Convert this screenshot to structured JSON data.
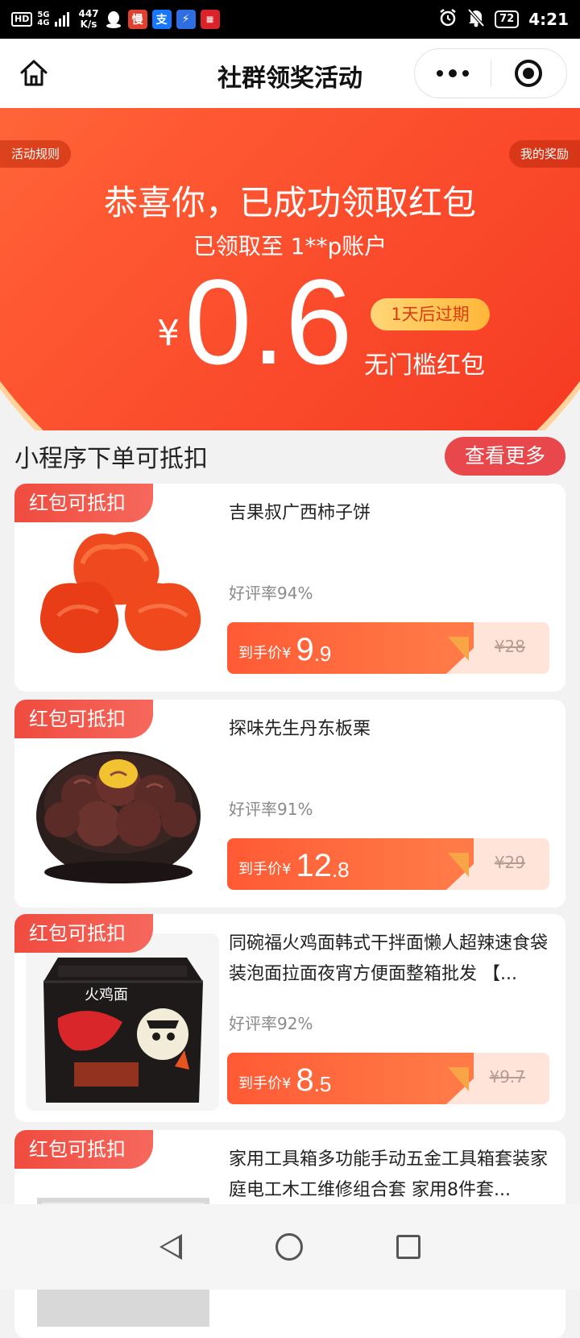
{
  "status_bar": {
    "hd": "HD",
    "network_top": "5G",
    "network_bottom": "4G",
    "speed_value": "447",
    "speed_unit": "K/s",
    "battery": "72",
    "time": "4:21"
  },
  "navbar": {
    "title": "社群领奖活动"
  },
  "banner": {
    "rules_label": "活动规则",
    "rewards_label": "我的奖励",
    "congrats": "恭喜你，已成功领取红包",
    "account_text": "已领取至 1**p账户",
    "currency": "¥",
    "amount": "0.6",
    "expire": "1天后过期",
    "type": "无门槛红包"
  },
  "section": {
    "title": "小程序下单可抵扣",
    "more_label": "查看更多"
  },
  "products": [
    {
      "badge": "红包可抵扣",
      "name": "吉果叔广西柿子饼",
      "rate": "好评率94%",
      "price_label": "到手价¥",
      "price_int": "9",
      "price_dec": ".9",
      "original_price": "¥28",
      "image": "persimmon-cake-image"
    },
    {
      "badge": "红包可抵扣",
      "name": "探味先生丹东板栗",
      "rate": "好评率91%",
      "price_label": "到手价¥",
      "price_int": "12",
      "price_dec": ".8",
      "original_price": "¥29",
      "image": "chestnut-image"
    },
    {
      "badge": "红包可抵扣",
      "name": "同碗福火鸡面韩式干拌面懒人超辣速食袋装泡面拉面夜宵方便面整箱批发 【...",
      "rate": "好评率92%",
      "price_label": "到手价¥",
      "price_int": "8",
      "price_dec": ".5",
      "original_price": "¥9.7",
      "image": "instant-noodles-image",
      "pack_text": "火鸡面"
    },
    {
      "badge": "红包可抵扣",
      "name": "家用工具箱多功能手动五金工具箱套装家庭电工木工维修组合套 家用8件套...",
      "image": "toolbox-image"
    }
  ]
}
